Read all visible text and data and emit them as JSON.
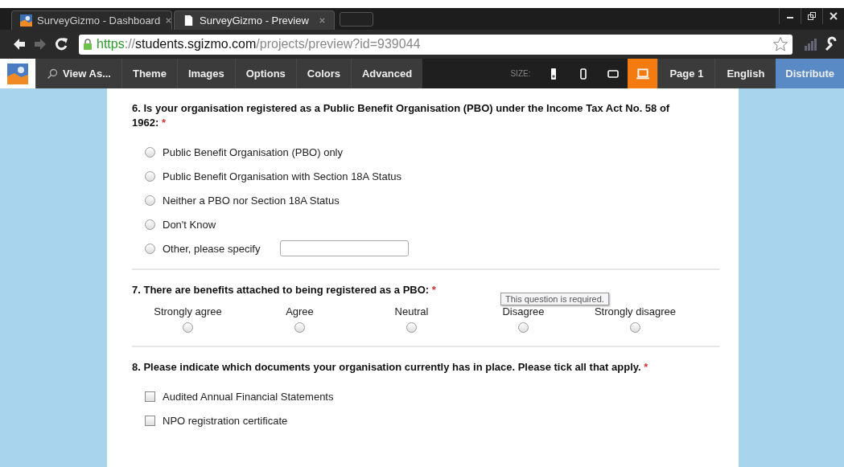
{
  "browser": {
    "tabs": [
      {
        "title": "SurveyGizmo - Dashboard",
        "kind": "logo",
        "selected": false
      },
      {
        "title": "SurveyGizmo - Preview",
        "kind": "page",
        "selected": true
      }
    ],
    "url": [
      {
        "text": "https",
        "kind": "scheme"
      },
      {
        "text": "://",
        "kind": "dim"
      },
      {
        "text": "students.sgizmo.com",
        "kind": "host"
      },
      {
        "text": "/projects/preview?id=939044",
        "kind": "dim"
      }
    ]
  },
  "toolbar": {
    "view_as": "View As...",
    "menu": [
      "Theme",
      "Images",
      "Options",
      "Colors",
      "Advanced"
    ],
    "size_label": "SIZE:",
    "sizes": [
      {
        "kind": "small-phone",
        "selected": false
      },
      {
        "kind": "phone",
        "selected": false
      },
      {
        "kind": "tablet",
        "selected": false
      },
      {
        "kind": "laptop",
        "selected": true
      }
    ],
    "page": "Page 1",
    "language": "English",
    "distribute": "Distribute"
  },
  "questions": [
    {
      "kind": "radio",
      "title": "6. Is your organisation registered as a Public Benefit Organisation (PBO) under the Income Tax Act No. 58 of 1962:",
      "required_mark": "*",
      "options": [
        {
          "label": "Public Benefit Organisation (PBO) only",
          "selected": false
        },
        {
          "label": "Public Benefit Organisation with Section 18A Status",
          "selected": false
        },
        {
          "label": "Neither a PBO nor Section 18A Status",
          "selected": false
        },
        {
          "label": "Don't Know",
          "selected": false
        },
        {
          "label": "Other, please specify",
          "selected": false,
          "other_field": true
        }
      ]
    },
    {
      "kind": "scale",
      "title": "7. There are benefits attached to being registered as a PBO:",
      "required_mark": "*",
      "tooltip": "This question is required.",
      "options": [
        {
          "label": "Strongly agree",
          "selected": false
        },
        {
          "label": "Agree",
          "selected": false
        },
        {
          "label": "Neutral",
          "selected": false
        },
        {
          "label": "Disagree",
          "selected": false
        },
        {
          "label": "Strongly disagree",
          "selected": false
        }
      ]
    },
    {
      "kind": "checkbox",
      "title": "8. Please indicate which documents your organisation currently has in place. Please tick all that apply.",
      "required_mark": "*",
      "options": [
        {
          "label": "Audited Annual Financial Statements",
          "checked": false
        },
        {
          "label": "NPO registration certificate",
          "checked": false
        }
      ]
    }
  ]
}
